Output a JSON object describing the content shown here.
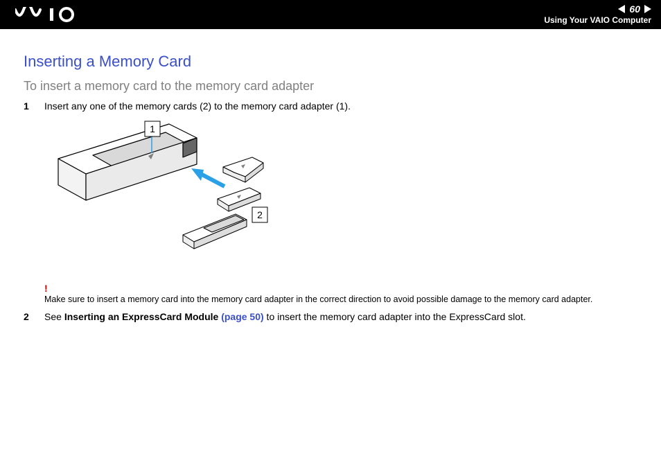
{
  "header": {
    "page_number": "60",
    "breadcrumb": "Using Your VAIO Computer"
  },
  "heading": "Inserting a Memory Card",
  "subheading": "To insert a memory card to the memory card adapter",
  "step1": {
    "num": "1",
    "text": "Insert any one of the memory cards (2) to the memory card adapter (1)."
  },
  "callouts": {
    "a": "1",
    "b": "2"
  },
  "warning": {
    "mark": "!",
    "text": "Make sure to insert a memory card into the memory card adapter in the correct direction to avoid possible damage to the memory card adapter."
  },
  "step2": {
    "num": "2",
    "text_a": "See ",
    "link_bold": "Inserting an ExpressCard Module ",
    "link_page": "(page 50)",
    "text_b": " to insert the memory card adapter into the ExpressCard slot."
  }
}
